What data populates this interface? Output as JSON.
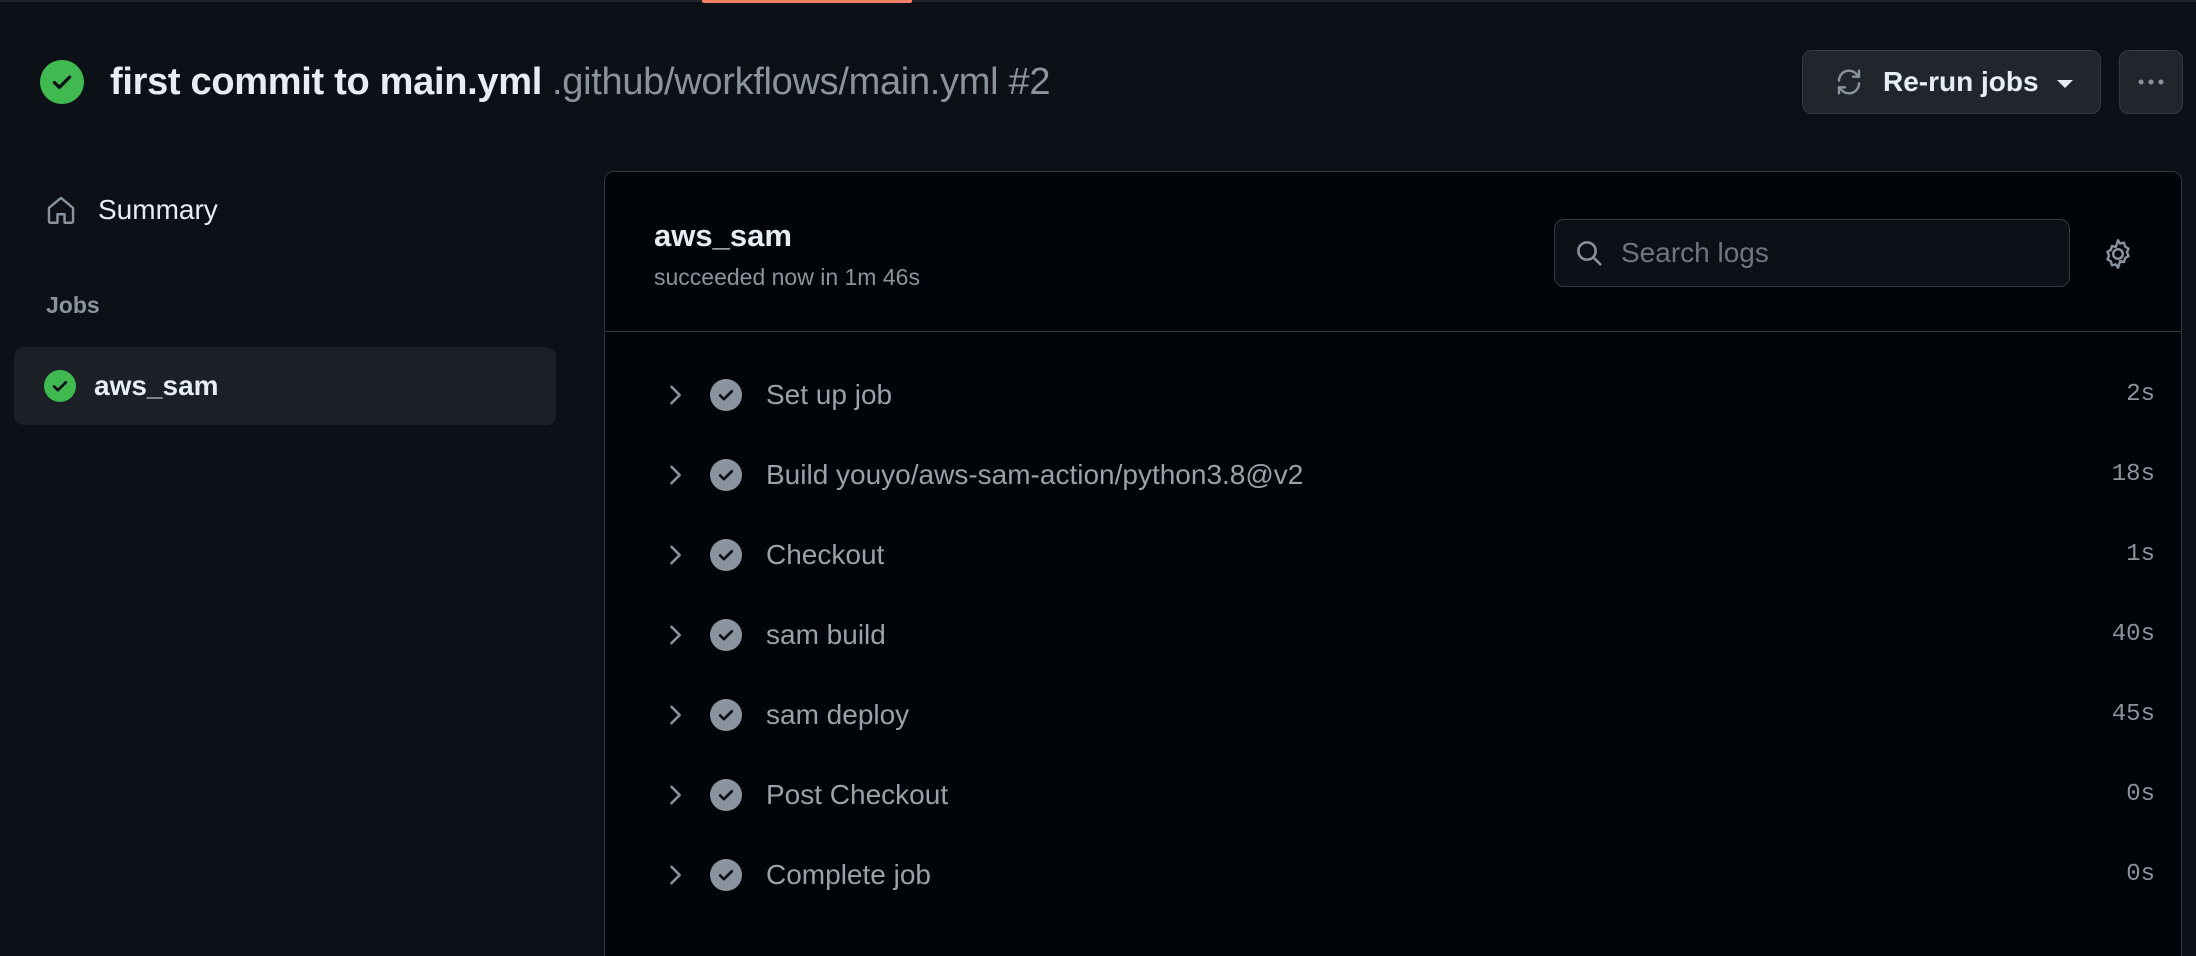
{
  "header": {
    "title": "first commit to main.yml",
    "subtitle": ".github/workflows/main.yml #2",
    "rerun_label": "Re-run jobs",
    "status_icon": "check-circle-icon",
    "status_color": "#3fb950"
  },
  "sidebar": {
    "summary_label": "Summary",
    "jobs_heading": "Jobs",
    "jobs": [
      {
        "label": "aws_sam",
        "status": "success"
      }
    ]
  },
  "job": {
    "title": "aws_sam",
    "status_text": "succeeded now in 1m 46s"
  },
  "search": {
    "placeholder": "Search logs"
  },
  "steps": [
    {
      "name": "Set up job",
      "duration": "2s"
    },
    {
      "name": "Build youyo/aws-sam-action/python3.8@v2",
      "duration": "18s"
    },
    {
      "name": "Checkout",
      "duration": "1s"
    },
    {
      "name": "sam build",
      "duration": "40s"
    },
    {
      "name": "sam deploy",
      "duration": "45s"
    },
    {
      "name": "Post Checkout",
      "duration": "0s"
    },
    {
      "name": "Complete job",
      "duration": "0s"
    }
  ],
  "colors": {
    "background": "#0d1117",
    "panel": "#010409",
    "accent_tab": "#f78166",
    "success": "#3fb950",
    "step_icon": "#8b949e"
  }
}
